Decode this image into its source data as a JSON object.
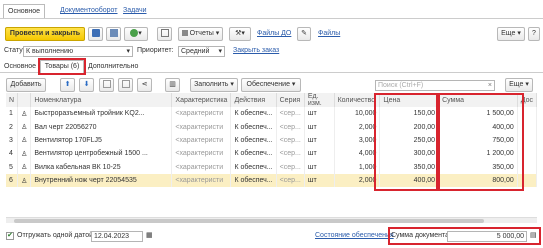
{
  "top_tabs": [
    "Основное",
    "Документооборот",
    "Задачи"
  ],
  "toolbar": {
    "post_close": "Провести и закрыть",
    "reports": "Отчеты",
    "files_do": "Файлы ДО",
    "files": "Файлы",
    "more": "Еще",
    "help": "?"
  },
  "status_row": {
    "status_label": "Статус:",
    "status_value": "К выполнению",
    "priority_label": "Приоритет:",
    "priority_value": "Средний",
    "close_link": "Закрыть заказ"
  },
  "section_tabs": [
    "Основное",
    "Товары (6)",
    "Дополнительно"
  ],
  "grid_toolbar": {
    "add": "Добавить",
    "fill": "Заполнить",
    "provision": "Обеспечение",
    "search_placeholder": "Поиск (Ctrl+F)",
    "more": "Еще"
  },
  "columns": [
    "N",
    "",
    "Номенклатура",
    "Характеристика",
    "Действия",
    "Серия",
    "Ед. изм.",
    "Количество",
    "Цена",
    "Сумма",
    "Дос"
  ],
  "rows": [
    {
      "n": "1",
      "name": "Быстроразъемный тройник KQ2...",
      "char": "<характеристи",
      "action": "К обеспеч...",
      "series": "<сер...",
      "unit": "шт",
      "qty": "10,000",
      "price": "150,00",
      "sum": "1 500,00"
    },
    {
      "n": "2",
      "name": "Вал черт 22056270",
      "char": "<характеристи",
      "action": "К обеспеч...",
      "series": "<сер...",
      "unit": "шт",
      "qty": "2,000",
      "price": "200,00",
      "sum": "400,00"
    },
    {
      "n": "3",
      "name": "Вентилятор 170FLJ5",
      "char": "<характеристи",
      "action": "К обеспеч...",
      "series": "<сер...",
      "unit": "шт",
      "qty": "3,000",
      "price": "250,00",
      "sum": "750,00"
    },
    {
      "n": "4",
      "name": "Вентилятор центробежный 1500 ...",
      "char": "<характеристи",
      "action": "К обеспеч...",
      "series": "<сер...",
      "unit": "шт",
      "qty": "4,000",
      "price": "300,00",
      "sum": "1 200,00"
    },
    {
      "n": "5",
      "name": "Вилка кабельная ВК 10-25",
      "char": "<характеристи",
      "action": "К обеспеч...",
      "series": "<сер...",
      "unit": "шт",
      "qty": "1,000",
      "price": "350,00",
      "sum": "350,00"
    },
    {
      "n": "6",
      "name": "Внутренний нож черт 22054535",
      "char": "<характеристи",
      "action": "К обеспеч...",
      "series": "<сер...",
      "unit": "шт",
      "qty": "2,000",
      "price": "400,00",
      "sum": "800,00"
    }
  ],
  "bottom": {
    "ship_one_date": "Отгружать одной датой",
    "date": "12.04.2023",
    "provision_state": "Состояние обеспечения",
    "total_label": "Сумма документа:",
    "total_value": "5 000,00"
  }
}
